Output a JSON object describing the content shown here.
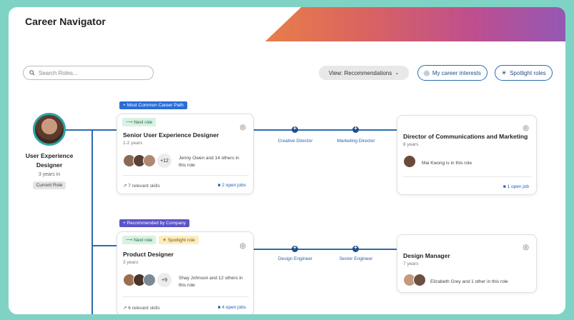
{
  "app": {
    "title": "Career Navigator"
  },
  "search": {
    "placeholder": "Search Roles..."
  },
  "toolbar": {
    "view_label": "View: Recommendations",
    "interests_label": "My career interests",
    "spotlight_label": "Spotlight roles"
  },
  "current": {
    "title": "User Experience Designer",
    "tenure": "3 years in",
    "badge": "Current Role"
  },
  "paths": [
    {
      "tag": "Most Common Career Path",
      "card": {
        "chips": [
          "Next role"
        ],
        "title": "Senior User Experience Designer",
        "years": "1-2 years",
        "more_count": "+12",
        "people_text": "Jenny Owen and 14 others in this role",
        "skills": "7 relevant skills",
        "jobs": "2 open jobs"
      },
      "steps": [
        "Creative Director",
        "Marketing Director"
      ],
      "target": {
        "title": "Director of Communications and Marketing",
        "years": "8 years",
        "people_text": "Mai Kwong is in this role",
        "jobs": "1 open job"
      }
    },
    {
      "tag": "Recommended by Company",
      "card": {
        "chips": [
          "Next role",
          "Spotlight role"
        ],
        "title": "Product Designer",
        "years": "3 years",
        "more_count": "+9",
        "people_text": "Shay Johnson and 12 others in this role",
        "skills": "6 relevant skills",
        "jobs": "4 open jobs"
      },
      "steps": [
        "Design Engineer",
        "Senior Engineer"
      ],
      "target": {
        "title": "Design Manager",
        "years": "7 years",
        "people_text": "Elizabeth Grey and 1 other in this role"
      }
    }
  ],
  "colors": {
    "accent": "#2b6cb0",
    "frame_bg": "#7fd3c4",
    "tag_blue": "#2a6ed8",
    "tag_purple": "#5a54c8"
  }
}
